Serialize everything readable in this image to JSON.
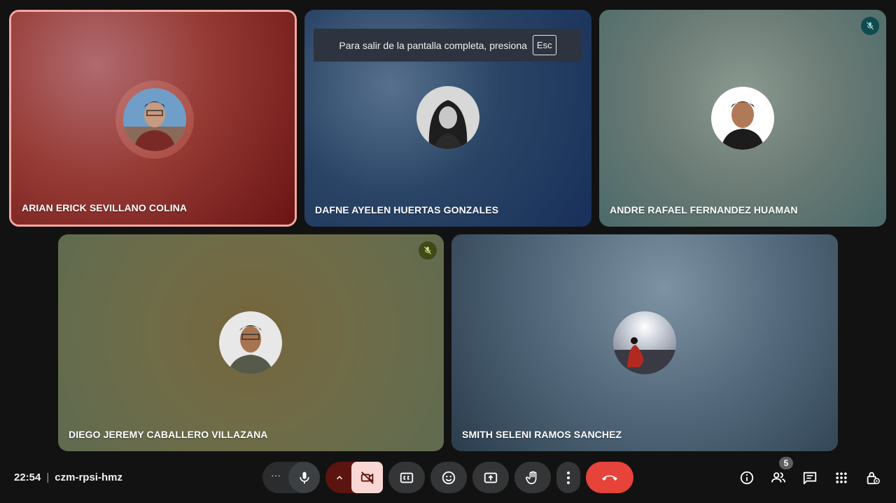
{
  "notice": {
    "text": "Para salir de la pantalla completa, presiona",
    "key": "Esc"
  },
  "participants": [
    {
      "name": "ARIAN ERICK SEVILLANO COLINA",
      "muted": false,
      "speaking": true
    },
    {
      "name": "DAFNE AYELEN HUERTAS GONZALES",
      "muted": false,
      "speaking": false
    },
    {
      "name": "ANDRE RAFAEL FERNANDEZ HUAMAN",
      "muted": true,
      "speaking": false
    },
    {
      "name": "DIEGO JEREMY CABALLERO VILLAZANA",
      "muted": true,
      "speaking": false
    },
    {
      "name": "SMITH SELENI RAMOS SANCHEZ",
      "muted": false,
      "speaking": false
    }
  ],
  "meeting": {
    "time": "22:54",
    "separator": "|",
    "code": "czm-rpsi-hmz"
  },
  "controls": {
    "more_dots": "···",
    "participant_count": "5"
  },
  "colors": {
    "speaking_border": "#f4a8a0",
    "end_call": "#e6433a",
    "camera_off_bg": "#f8d7d4",
    "camera_menu_bg": "#5c1410"
  }
}
